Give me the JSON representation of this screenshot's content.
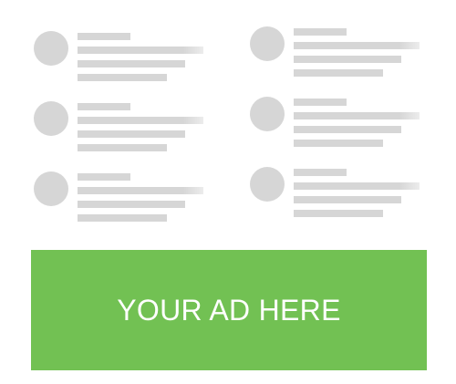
{
  "ad": {
    "text": "YOUR AD HERE",
    "background_color": "#72c153",
    "text_color": "#ffffff"
  },
  "placeholder_color": "#d6d6d6",
  "placeholders": {
    "columns": 2,
    "rows": 3,
    "lines_per_item": 4
  }
}
